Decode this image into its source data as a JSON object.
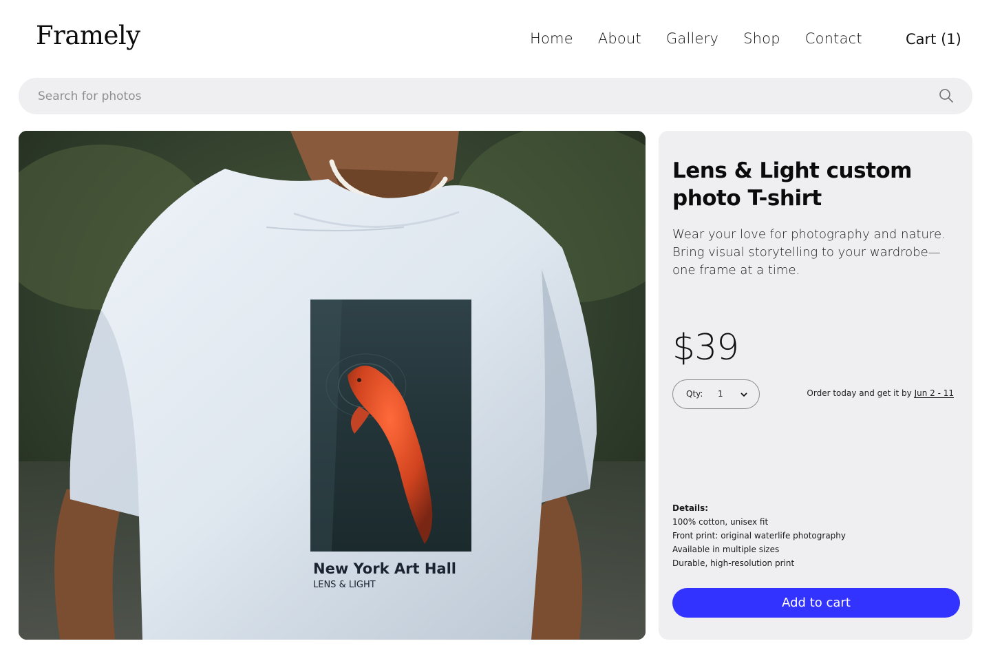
{
  "brand": {
    "logo": "Framely"
  },
  "nav": {
    "items": [
      {
        "label": "Home"
      },
      {
        "label": "About"
      },
      {
        "label": "Gallery"
      },
      {
        "label": "Shop"
      },
      {
        "label": "Contact"
      }
    ],
    "cart_label": "Cart (1)"
  },
  "search": {
    "placeholder": "Search for photos",
    "value": "",
    "icon": "search-icon"
  },
  "product_image": {
    "print_title": "New York Art Hall",
    "print_subtitle": "LENS & LIGHT"
  },
  "product": {
    "title": "Lens & Light custom photo T-shirt",
    "description": "Wear your love for photography and nature. Bring visual storytelling to your wardrobe—one frame at a time.",
    "price": "$39",
    "qty_label": "Qty:",
    "qty_value": "1",
    "shipping_prefix": "Order today and get it by",
    "shipping_date": "Jun 2 - 11",
    "details_heading": "Details:",
    "details": [
      "100% cotton, unisex fit",
      "Front print: original waterlife photography",
      "Available in multiple sizes",
      "Durable, high-resolution print"
    ],
    "add_to_cart": "Add to cart"
  },
  "colors": {
    "accent": "#3333ff",
    "panel_bg": "#efeff1",
    "search_bg": "#efeff1"
  }
}
